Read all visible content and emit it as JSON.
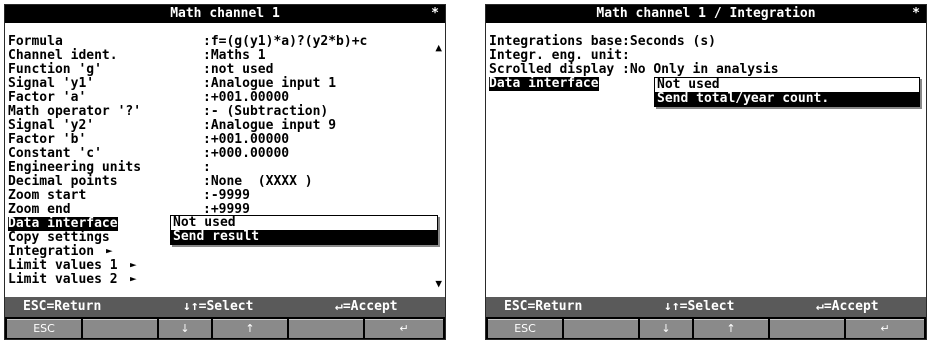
{
  "left": {
    "title": "Math channel 1",
    "star": "*",
    "rows": [
      {
        "label": "Formula",
        "value": ":f=(g(y1)*a)?(y2*b)+c"
      },
      {
        "label": "Channel ident.",
        "value": ":Maths 1"
      },
      {
        "label": "Function 'g'",
        "value": ":not used"
      },
      {
        "label": "Signal 'y1'",
        "value": ":Analogue input 1"
      },
      {
        "label": "Factor 'a'",
        "value": ":+001.00000"
      },
      {
        "label": "Math operator '?'",
        "value": ":- (Subtraction)"
      },
      {
        "label": "Signal 'y2'",
        "value": ":Analogue input 9"
      },
      {
        "label": "Factor 'b'",
        "value": ":+001.00000"
      },
      {
        "label": "Constant 'c'",
        "value": ":+000.00000"
      },
      {
        "label": "Engineering units",
        "value": ":"
      },
      {
        "label": "Decimal points",
        "value": ":None  (XXXX )"
      },
      {
        "label": "Zoom start",
        "value": ":-9999"
      },
      {
        "label": "Zoom end",
        "value": ":+9999"
      },
      {
        "label": "Data interface",
        "value": ""
      },
      {
        "label": "Copy settings",
        "value": ""
      },
      {
        "label": "Integration",
        "value": ""
      },
      {
        "label": "Limit values 1",
        "value": ""
      },
      {
        "label": "Limit values 2",
        "value": ""
      }
    ],
    "arrow": "►",
    "popup": [
      "Not used",
      "Send result"
    ],
    "scroll_up": "▲",
    "scroll_down": "▼"
  },
  "right": {
    "title": "Math channel 1 / Integration",
    "star": "*",
    "rows": [
      {
        "label": "Integrations base:Seconds (s)"
      },
      {
        "label": "Integr. eng. unit:"
      },
      {
        "label": "Scrolled display :No Only in analysis"
      },
      {
        "label": "Data interface"
      }
    ],
    "popup": [
      "Not used",
      "Send total/year count."
    ]
  },
  "footer": {
    "esc_hint": "ESC=Return",
    "select_hint": "↓↑=Select",
    "accept_hint": "↵=Accept",
    "keys": [
      "ESC",
      "",
      "↓",
      "↑",
      "",
      "↵"
    ]
  },
  "colors": {
    "bar": "#000000",
    "hint_bg": "#5a5a5a",
    "key_bg": "#8a8a8a"
  }
}
